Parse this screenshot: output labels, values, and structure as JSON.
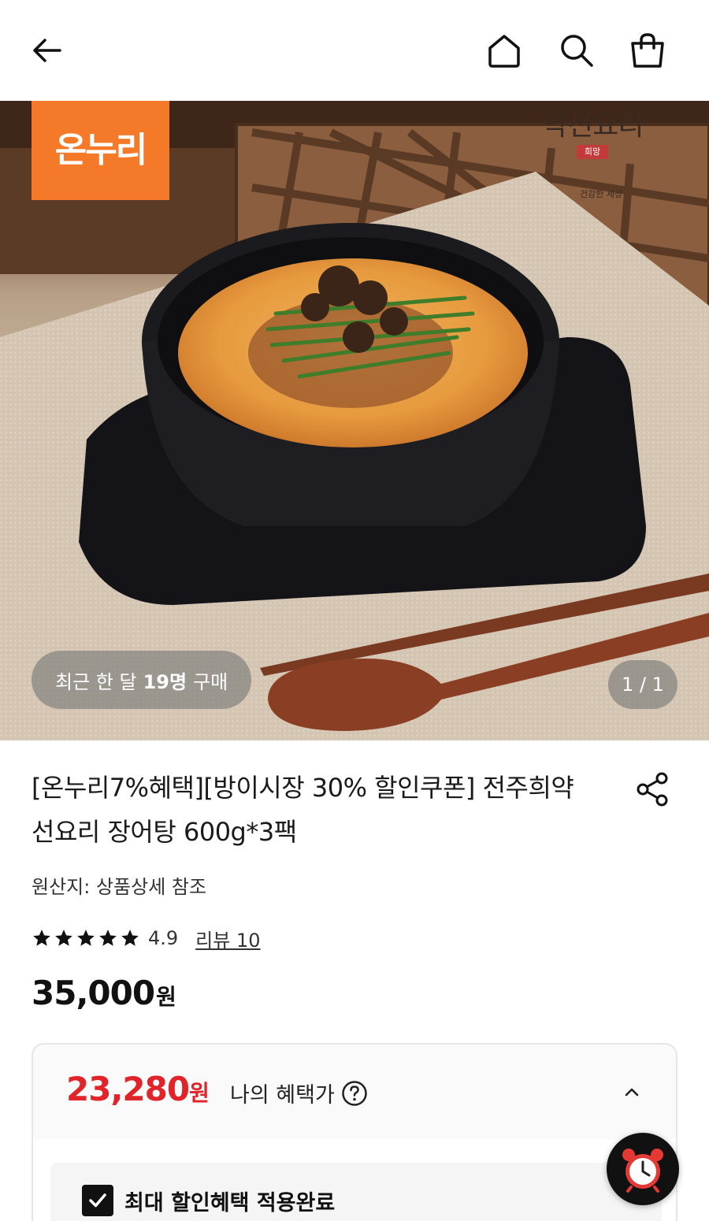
{
  "header": {
    "back_icon": "arrow-left-icon",
    "home_icon": "home-icon",
    "search_icon": "search-icon",
    "cart_icon": "shopping-bag-icon"
  },
  "hero": {
    "onnuri_badge": "온누리",
    "brand_logo": {
      "name": "약선요리",
      "seal": "희망",
      "tagline": "건강한 세상"
    },
    "recent_purchase": {
      "prefix": "최근 한 달",
      "count": "19명",
      "suffix": "구매"
    },
    "page_indicator": "1 / 1",
    "colors": {
      "badge": "#f47a2a"
    }
  },
  "product": {
    "title": "[온누리7%혜택][방이시장 30% 할인쿠폰] 전주희약선요리 장어탕 600g*3팩",
    "origin": "원산지: 상품상세 참조",
    "rating_value": "4.9",
    "rating_stars": 5,
    "review_link": "리뷰 10",
    "price": "35,000",
    "price_unit": "원",
    "share_icon": "share-icon"
  },
  "benefit": {
    "sale_price": "23,280",
    "sale_unit": "원",
    "label": "나의 혜택가",
    "help_icon": "question-circle-icon",
    "toggle_icon": "chevron-up-icon",
    "applied_label": "최대 할인혜택 적용완료",
    "colors": {
      "sale": "#e0242a"
    }
  },
  "fab": {
    "icon": "alarm-clock-icon"
  }
}
